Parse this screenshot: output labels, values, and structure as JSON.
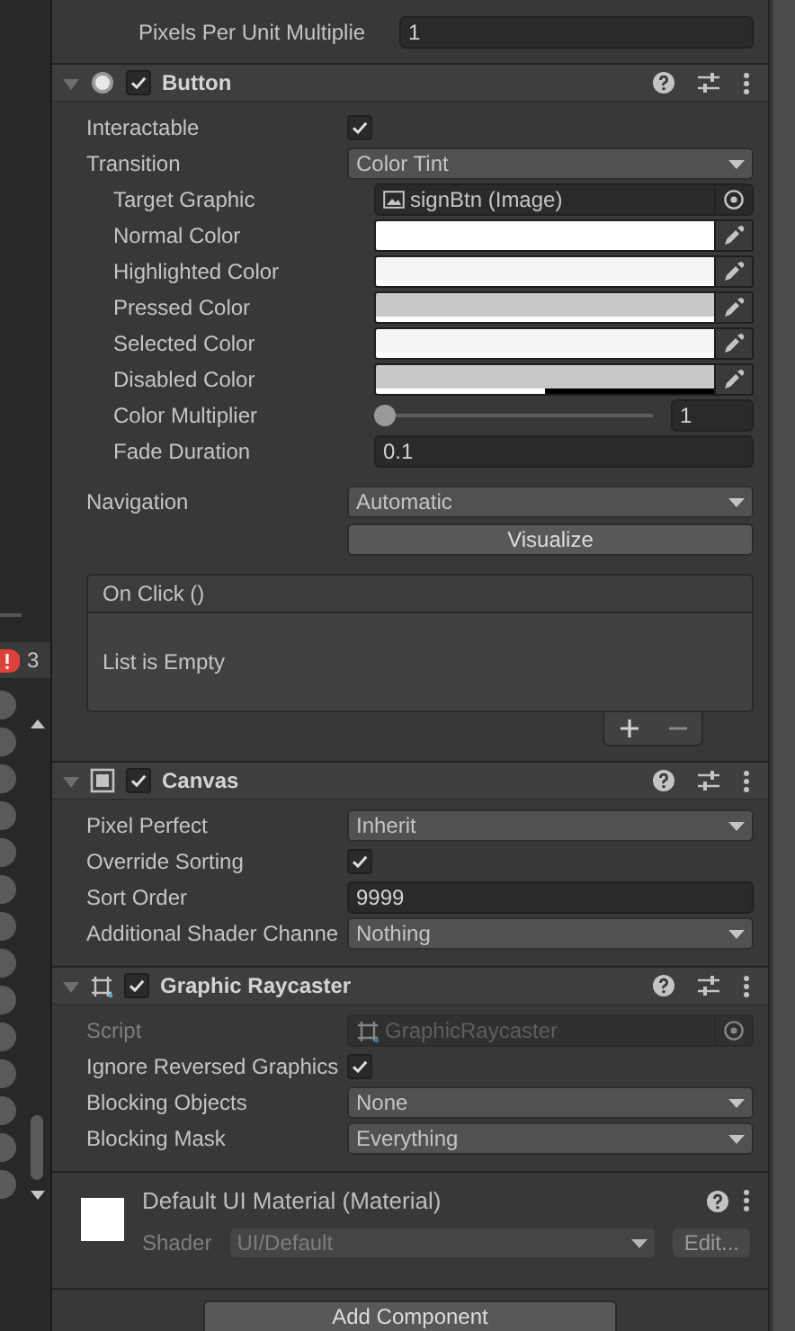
{
  "hierarchy": {
    "badge": "3"
  },
  "top_fields": [
    {
      "kind": "text",
      "label": "Pixels Per Unit Multiplie",
      "value": "1"
    }
  ],
  "components": [
    {
      "title": "Button",
      "enabled": true,
      "expanded": true,
      "fields": [
        {
          "kind": "checkbox",
          "label": "Interactable",
          "checked": true
        },
        {
          "kind": "dropdown",
          "label": "Transition",
          "value": "Color Tint",
          "children": [
            {
              "kind": "object",
              "label": "Target Graphic",
              "value": "signBtn (Image)"
            },
            {
              "kind": "color",
              "label": "Normal Color",
              "color": "#ffffff",
              "level": 1
            },
            {
              "kind": "color",
              "label": "Highlighted Color",
              "color": "#f5f5f5",
              "level": 1
            },
            {
              "kind": "color",
              "label": "Pressed Color",
              "color": "#c8c8c8",
              "level": 1
            },
            {
              "kind": "color",
              "label": "Selected Color",
              "color": "#f5f5f5",
              "level": 1
            },
            {
              "kind": "color",
              "label": "Disabled Color",
              "color": "#c8c8c8",
              "level": 0.5
            },
            {
              "kind": "slider",
              "label": "Color Multiplier",
              "level": 0,
              "value": "1"
            },
            {
              "kind": "text",
              "label": "Fade Duration",
              "value": "0.1"
            }
          ]
        },
        {
          "kind": "dropdown",
          "label": "Navigation",
          "value": "Automatic"
        },
        {
          "kind": "button",
          "label": "Visualize"
        },
        {
          "kind": "event",
          "label": "On Click ()",
          "value": "List is Empty"
        }
      ]
    },
    {
      "title": "Canvas",
      "enabled": true,
      "expanded": true,
      "fields": [
        {
          "kind": "dropdown",
          "label": "Pixel Perfect",
          "value": "Inherit"
        },
        {
          "kind": "checkbox",
          "label": "Override Sorting",
          "checked": true
        },
        {
          "kind": "text",
          "label": "Sort Order",
          "value": "9999"
        },
        {
          "kind": "dropdown",
          "label": "Additional Shader Channe",
          "value": "Nothing"
        }
      ]
    },
    {
      "title": "Graphic Raycaster",
      "enabled": true,
      "expanded": true,
      "fields": [
        {
          "kind": "script",
          "label": "Script",
          "value": "GraphicRaycaster",
          "disabled": true
        },
        {
          "kind": "checkbox",
          "label": "Ignore Reversed Graphics",
          "checked": true
        },
        {
          "kind": "dropdown",
          "label": "Blocking Objects",
          "value": "None"
        },
        {
          "kind": "dropdown",
          "label": "Blocking Mask",
          "value": "Everything"
        }
      ]
    }
  ],
  "material": {
    "title": "Default UI Material (Material)",
    "shader_label": "Shader",
    "shader": "UI/Default",
    "edit": "Edit..."
  },
  "add_component": "Add Component"
}
